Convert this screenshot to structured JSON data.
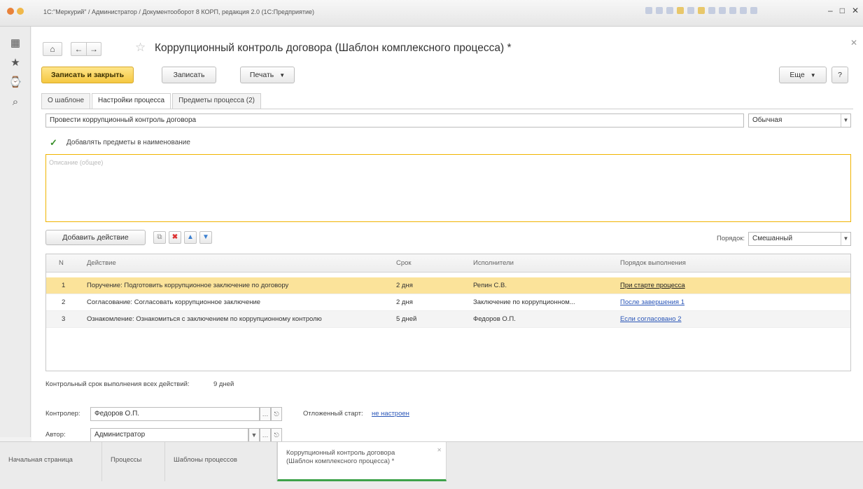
{
  "window": {
    "title": "1С:\"Меркурий\" / Администратор / Документооборот 8 КОРП, редакция 2.0 (1С:Предприятие)"
  },
  "form": {
    "title": "Коррупционный контроль договора (Шаблон комплексного процесса) *"
  },
  "toolbar": {
    "save_close": "Записать и закрыть",
    "save": "Записать",
    "print": "Печать",
    "more": "Еще",
    "help": "?"
  },
  "tabs": [
    "О шаблоне",
    "Настройки процесса",
    "Предметы процесса (2)"
  ],
  "settings": {
    "name_value": "Провести коррупционный контроль договора",
    "importance": "Обычная",
    "add_subjects_label": "Добавлять предметы в наименование",
    "add_subjects_checked": true,
    "description_placeholder": "Описание (общее)"
  },
  "actions_toolbar": {
    "add_action": "Добавить действие",
    "order_label": "Порядок:",
    "order_value": "Смешанный"
  },
  "table": {
    "columns": [
      "N",
      "Действие",
      "Срок",
      "Исполнители",
      "Порядок выполнения"
    ],
    "rows": [
      {
        "n": "1",
        "action": "Поручение: Подготовить коррупционное заключение по договору",
        "term": "2 дня",
        "executors": "Репин С.В.",
        "order": "При старте процесса"
      },
      {
        "n": "2",
        "action": "Согласование: Согласовать коррупционное заключение",
        "term": "2 дня",
        "executors": "Заключение по коррупционном...",
        "order": "После завершения 1"
      },
      {
        "n": "3",
        "action": "Ознакомление: Ознакомиться с заключением по коррупционному контролю",
        "term": "5 дней",
        "executors": "Федоров О.П.",
        "order": "Если согласовано 2"
      }
    ]
  },
  "footer": {
    "control_term_label": "Контрольный срок выполнения всех действий:",
    "control_term_value": "9 дней",
    "controller_label": "Контролер:",
    "controller_value": "Федоров О.П.",
    "delayed_start_label": "Отложенный старт:",
    "delayed_start_value": "не настроен",
    "author_label": "Автор:",
    "author_value": "Администратор"
  },
  "bottom_tabs": [
    "Начальная страница",
    "Процессы",
    "Шаблоны процессов",
    "Коррупционный контроль договора",
    "(Шаблон комплексного процесса) *"
  ]
}
